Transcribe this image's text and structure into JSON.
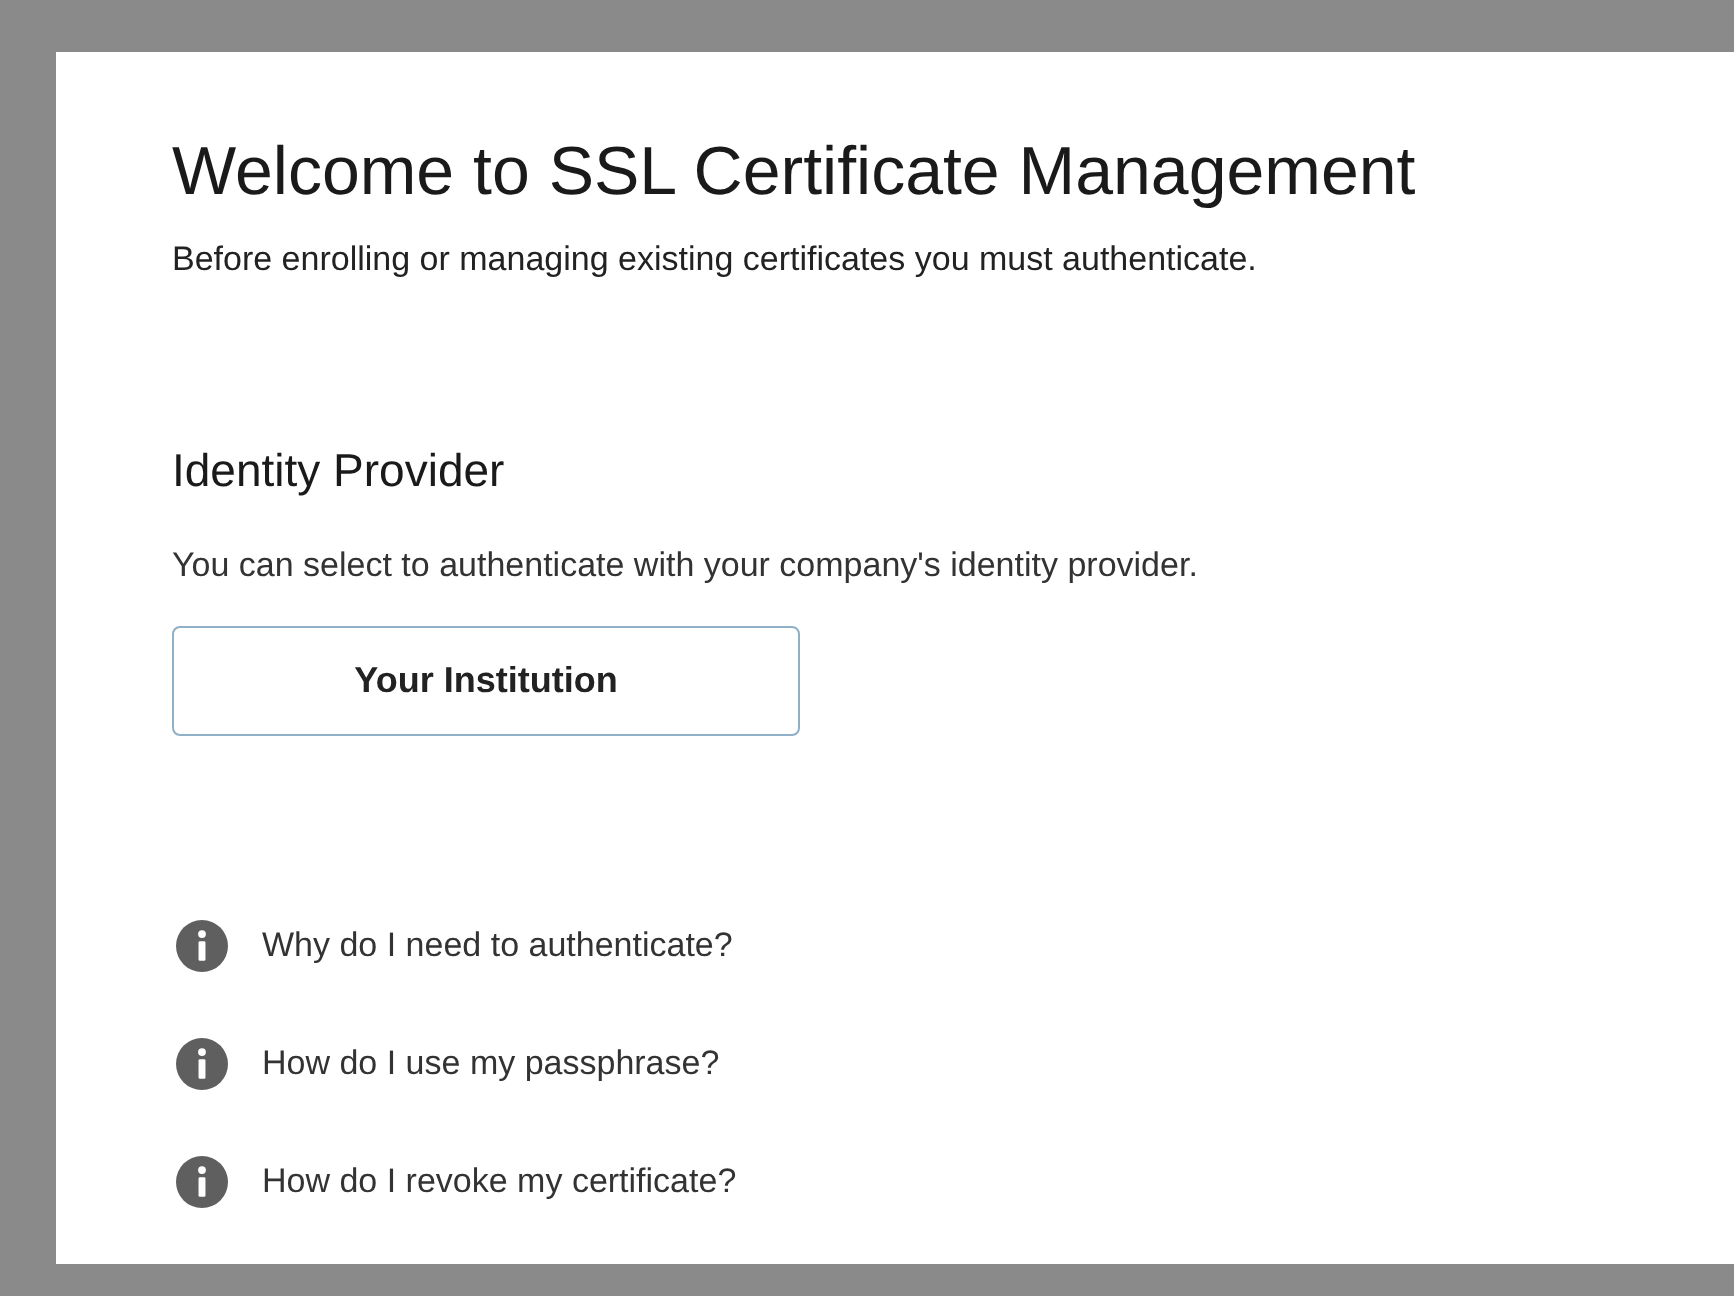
{
  "title": "Welcome to SSL Certificate Management",
  "intro": "Before enrolling or managing existing certificates you must authenticate.",
  "identity_provider": {
    "heading": "Identity Provider",
    "description": "You can select to authenticate with your company's identity provider.",
    "button": "Your Institution"
  },
  "faq": [
    {
      "question": "Why do I need to authenticate?"
    },
    {
      "question": "How do I use my passphrase?"
    },
    {
      "question": "How do I revoke my certificate?"
    }
  ]
}
